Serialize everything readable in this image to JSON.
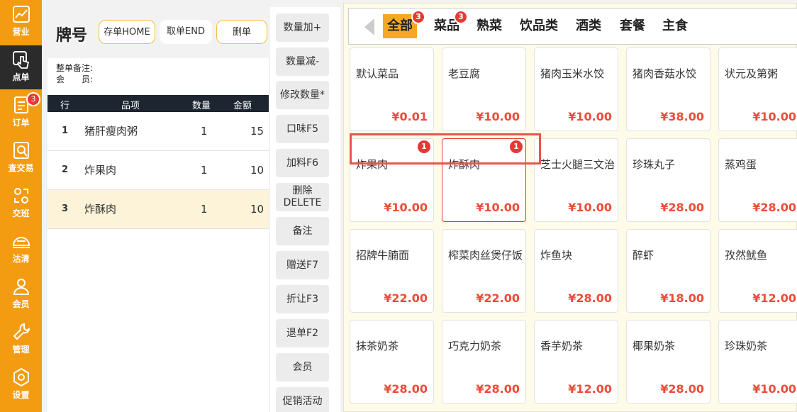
{
  "nav": {
    "items": [
      {
        "label": "营业",
        "icon": "chart-icon"
      },
      {
        "label": "点单",
        "icon": "touch-icon"
      },
      {
        "label": "订单",
        "icon": "document-icon",
        "badge": "3"
      },
      {
        "label": "查交易",
        "icon": "search-doc-icon"
      },
      {
        "label": "交班",
        "icon": "shift-icon"
      },
      {
        "label": "沽清",
        "icon": "dish-cover-icon"
      },
      {
        "label": "会员",
        "icon": "member-icon"
      },
      {
        "label": "管理",
        "icon": "wrench-icon"
      },
      {
        "label": "设置",
        "icon": "gear-icon"
      }
    ]
  },
  "order": {
    "title": "牌号",
    "buttons": {
      "save": "存单HOME",
      "fetch": "取单END",
      "delete": "删单"
    },
    "note_label": "整单备注:",
    "member_label": "会　　员:",
    "columns": {
      "row": "行",
      "item": "品项",
      "qty": "数量",
      "amount": "金额"
    },
    "rows": [
      {
        "no": "1",
        "name": "猪肝瘦肉粥",
        "qty": "1",
        "amount": "15"
      },
      {
        "no": "2",
        "name": "炸果肉",
        "qty": "1",
        "amount": "10"
      },
      {
        "no": "3",
        "name": "炸酥肉",
        "qty": "1",
        "amount": "10"
      }
    ]
  },
  "actions": [
    "数量加+",
    "数量减-",
    "修改数量*",
    "口味F5",
    "加料F6",
    "删除\nDELETE",
    "备注",
    "赠送F7",
    "折让F3",
    "退单F2",
    "会员",
    "促销活动"
  ],
  "categories": [
    {
      "label": "全部",
      "badge": "3"
    },
    {
      "label": "菜品",
      "badge": "3"
    },
    {
      "label": "熟菜"
    },
    {
      "label": "饮品类"
    },
    {
      "label": "酒类"
    },
    {
      "label": "套餐"
    },
    {
      "label": "主食"
    }
  ],
  "dishes": [
    {
      "name": "默认菜品",
      "price": "¥0.01"
    },
    {
      "name": "老豆腐",
      "price": "¥10.00"
    },
    {
      "name": "猪肉玉米水饺",
      "price": "¥10.00"
    },
    {
      "name": "猪肉香菇水饺",
      "price": "¥38.00"
    },
    {
      "name": "状元及第粥",
      "price": "¥10.00"
    },
    {
      "name": "炸果肉",
      "price": "¥10.00",
      "badge": "1"
    },
    {
      "name": "炸酥肉",
      "price": "¥10.00",
      "badge": "1"
    },
    {
      "name": "芝士火腿三文治",
      "price": "¥10.00"
    },
    {
      "name": "珍珠丸子",
      "price": "¥28.00"
    },
    {
      "name": "蒸鸡蛋",
      "price": "¥28.00"
    },
    {
      "name": "招牌牛腩面",
      "price": "¥22.00"
    },
    {
      "name": "榨菜肉丝煲仔饭",
      "price": "¥22.00"
    },
    {
      "name": "炸鱼块",
      "price": "¥28.00"
    },
    {
      "name": "醉虾",
      "price": "¥18.00"
    },
    {
      "name": "孜然鱿鱼",
      "price": "¥12.00"
    },
    {
      "name": "抹茶奶茶",
      "price": "¥28.00"
    },
    {
      "name": "巧克力奶茶",
      "price": "¥28.00"
    },
    {
      "name": "香芋奶茶",
      "price": "¥12.00"
    },
    {
      "name": "椰果奶茶",
      "price": "¥28.00"
    },
    {
      "name": "珍珠奶茶",
      "price": "¥10.00"
    }
  ]
}
